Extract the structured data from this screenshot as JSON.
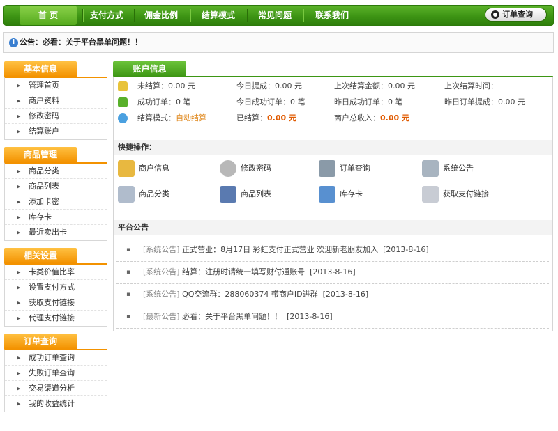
{
  "nav": {
    "items": [
      "首 页",
      "支付方式",
      "佣金比例",
      "结算模式",
      "常见问题",
      "联系我们"
    ],
    "order_query": "订单查询"
  },
  "notice": {
    "text": "公告：必看：关于平台黑单问题！！"
  },
  "sidebar": {
    "groups": [
      {
        "title": "基本信息",
        "items": [
          "管理首页",
          "商户资料",
          "修改密码",
          "结算账户"
        ]
      },
      {
        "title": "商品管理",
        "items": [
          "商品分类",
          "商品列表",
          "添加卡密",
          "库存卡",
          "最近卖出卡"
        ]
      },
      {
        "title": "相关设置",
        "items": [
          "卡类价值比率",
          "设置支付方式",
          "获取支付链接",
          "代理支付链接"
        ]
      },
      {
        "title": "订单查询",
        "items": [
          "成功订单查询",
          "失败订单查询",
          "交易渠道分析",
          "我的收益统计"
        ]
      }
    ]
  },
  "account": {
    "tab": "账户信息",
    "row1": {
      "unsettled": "未结算：0.00 元",
      "today_withdraw": "今日提成：0.00 元",
      "last_amount": "上次结算金额：0.00 元",
      "last_time": "上次结算时间："
    },
    "row2": {
      "success_orders": "成功订单：0 笔",
      "today_success": "今日成功订单：0 笔",
      "yesterday_success": "昨日成功订单：0 笔",
      "yesterday_withdraw": "昨日订单提成：0.00 元"
    },
    "row3": {
      "mode_label": "结算模式：",
      "mode_value": "自动结算",
      "settled_label": "已结算：",
      "settled_value": "0.00 元",
      "total_label": "商户总收入：",
      "total_value": "0.00 元"
    }
  },
  "quick": {
    "title": "快捷操作：",
    "items": [
      "商户信息",
      "修改密码",
      "订单查询",
      "系统公告",
      "商品分类",
      "商品列表",
      "库存卡",
      "获取支付链接"
    ]
  },
  "announcements": {
    "title": "平台公告",
    "items": [
      {
        "tag": "[系统公告]",
        "text": "正式营业：8月17日 彩虹支付正式营业 欢迎新老朋友加入",
        "date": "[2013-8-16]"
      },
      {
        "tag": "[系统公告]",
        "text": "结算：注册时请统一填写财付通账号",
        "date": "[2013-8-16]"
      },
      {
        "tag": "[系统公告]",
        "text": "QQ交流群：288060374 带商户ID进群",
        "date": "[2013-8-16]"
      },
      {
        "tag": "[最新公告]",
        "text": "必看：关于平台黑单问题！！",
        "date": "[2013-8-16]"
      }
    ]
  },
  "colors": {
    "nav_green": "#3d9414",
    "side_orange": "#f39200",
    "value_red": "#e05a00"
  }
}
